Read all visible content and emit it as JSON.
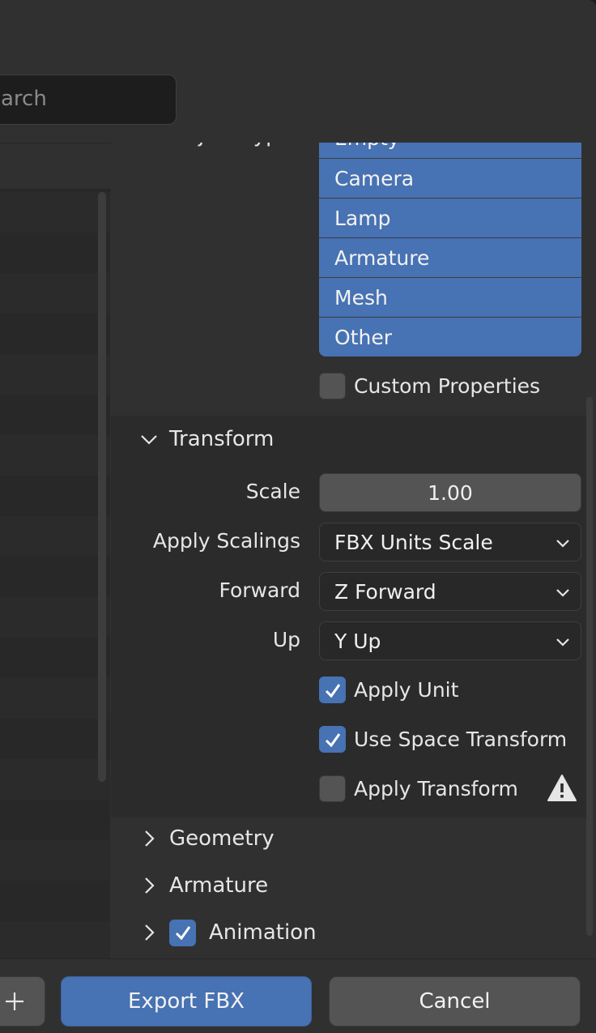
{
  "search": {
    "visible_text": "arch"
  },
  "object_types": {
    "label": "Object Types",
    "items": [
      "Empty",
      "Camera",
      "Lamp",
      "Armature",
      "Mesh",
      "Other"
    ]
  },
  "custom_properties": {
    "label": "Custom Properties",
    "checked": false
  },
  "transform": {
    "title": "Transform",
    "expanded": true,
    "scale_label": "Scale",
    "scale_value": "1.00",
    "apply_scalings_label": "Apply Scalings",
    "apply_scalings_value": "FBX Units Scale",
    "forward_label": "Forward",
    "forward_value": "Z Forward",
    "up_label": "Up",
    "up_value": "Y Up",
    "apply_unit_label": "Apply Unit",
    "apply_unit_checked": true,
    "use_space_transform_label": "Use Space Transform",
    "use_space_transform_checked": true,
    "apply_transform_label": "Apply Transform",
    "apply_transform_checked": false
  },
  "sections": {
    "geometry": "Geometry",
    "armature": "Armature",
    "animation": "Animation",
    "animation_checked": true
  },
  "footer": {
    "export_label": "Export FBX",
    "cancel_label": "Cancel"
  },
  "colors": {
    "accent": "#4772b3",
    "panel": "#303030",
    "field": "#545454",
    "dark": "#1d1d1d"
  }
}
